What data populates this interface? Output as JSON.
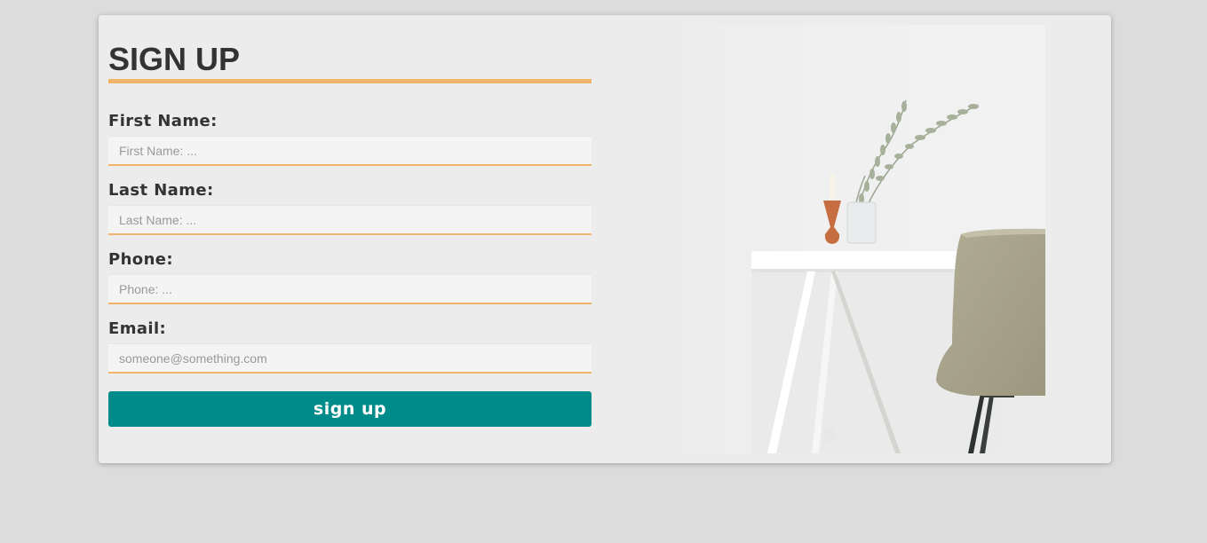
{
  "form": {
    "title": "SIGN UP",
    "fields": [
      {
        "label": "First Name:",
        "placeholder": "First Name: ..."
      },
      {
        "label": "Last Name:",
        "placeholder": "Last Name: ..."
      },
      {
        "label": "Phone:",
        "placeholder": "Phone: ..."
      },
      {
        "label": "Email:",
        "placeholder": "someone@something.com"
      }
    ],
    "submit_label": "sign up"
  },
  "colors": {
    "page_bg": "#dcdcdc",
    "card_bg": "#ececec",
    "accent": "#f0b46a",
    "button": "#008b8b",
    "text": "#333333"
  },
  "image": {
    "icon": "desk-chair-photo"
  }
}
